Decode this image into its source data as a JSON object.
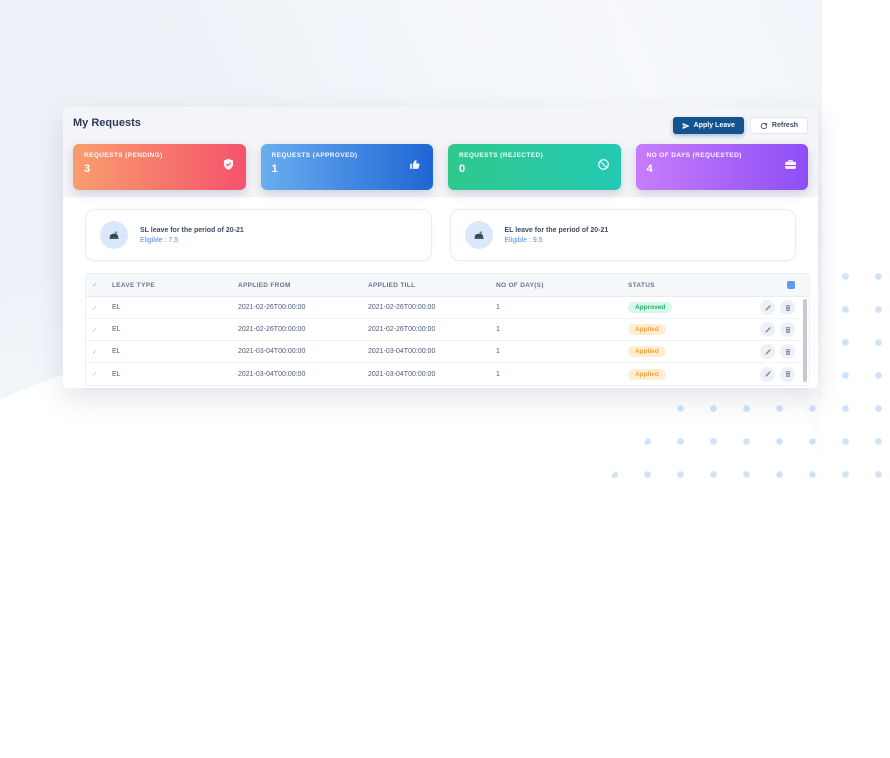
{
  "page": {
    "title": "My Requests"
  },
  "toolbar": {
    "apply_label": "Apply Leave",
    "refresh_label": "Refresh"
  },
  "icons": {
    "check_glyph": "✓"
  },
  "colors": {
    "primary_button": "#15538f",
    "page_background": "#edf1f7",
    "dots": "#cfe2f6",
    "eligible_text": "#4f8ef7"
  },
  "status_styles": {
    "approved": {
      "text": "#22b573",
      "bg": "#d8f6e9"
    },
    "applied": {
      "text": "#f0a23c",
      "bg": "#fdeed3"
    }
  },
  "stat_cards": [
    {
      "label": "REQUESTS (PENDING)",
      "value": "3",
      "icon": "shield-check-icon",
      "gradient_from": "#f89d6e",
      "gradient_to": "#f5536c"
    },
    {
      "label": "REQUESTS (APPROVED)",
      "value": "1",
      "icon": "thumbs-up-icon",
      "gradient_from": "#6aaef0",
      "gradient_to": "#1f66d4"
    },
    {
      "label": "REQUESTS (REJECTED)",
      "value": "0",
      "icon": "ban-icon",
      "gradient_from": "#2fc98e",
      "gradient_to": "#24c9b2"
    },
    {
      "label": "NO OF DAYS (REQUESTED)",
      "value": "4",
      "icon": "briefcase-icon",
      "gradient_from": "#c77dfa",
      "gradient_to": "#8e4ef5"
    }
  ],
  "leave_summary": [
    {
      "title": "SL leave for the period of 20-21",
      "eligible": "Eligible : 7.5",
      "icon": "leave-icon"
    },
    {
      "title": "EL leave for the period of 20-21",
      "eligible": "Eligible : 9.5",
      "icon": "leave-icon"
    }
  ],
  "table": {
    "columns": [
      "LEAVE TYPE",
      "APPLIED FROM",
      "APPLIED TILL",
      "NO OF DAY(S)",
      "STATUS"
    ],
    "rows": [
      {
        "leave_type": "EL",
        "applied_from": "2021-02-26T00:00:00",
        "applied_till": "2021-02-26T00:00:00",
        "days": "1",
        "status": "Approved",
        "status_kind": "approved"
      },
      {
        "leave_type": "EL",
        "applied_from": "2021-02-26T00:00:00",
        "applied_till": "2021-02-26T00:00:00",
        "days": "1",
        "status": "Applied",
        "status_kind": "applied"
      },
      {
        "leave_type": "EL",
        "applied_from": "2021-03-04T00:00:00",
        "applied_till": "2021-03-04T00:00:00",
        "days": "1",
        "status": "Applied",
        "status_kind": "applied"
      },
      {
        "leave_type": "EL",
        "applied_from": "2021-03-04T00:00:00",
        "applied_till": "2021-03-04T00:00:00",
        "days": "1",
        "status": "Applied",
        "status_kind": "applied"
      }
    ]
  }
}
